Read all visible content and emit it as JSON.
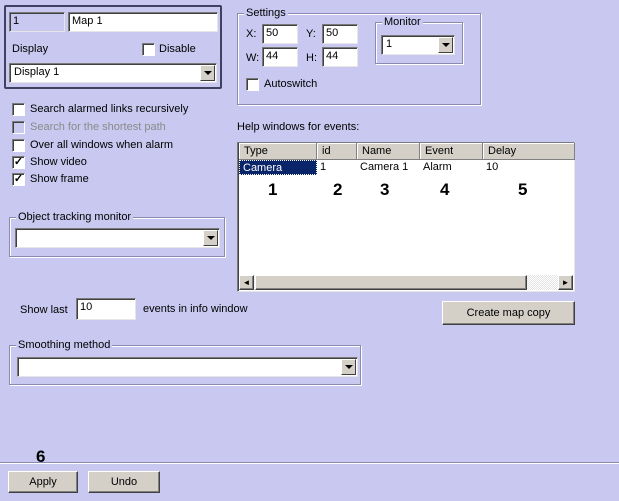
{
  "map": {
    "id": "1",
    "name": "Map 1",
    "display_label": "Display",
    "disable_label": "Disable",
    "display_value": "Display 1"
  },
  "settings": {
    "title": "Settings",
    "x_label": "X:",
    "x": "50",
    "y_label": "Y:",
    "y": "50",
    "w_label": "W:",
    "w": "44",
    "h_label": "H:",
    "h": "44",
    "autoswitch_label": "Autoswitch",
    "monitor_title": "Monitor",
    "monitor_value": "1"
  },
  "options": {
    "search_alarmed": "Search alarmed links recursively",
    "search_shortest": "Search for the shortest path",
    "over_all": "Over all windows when alarm",
    "show_video": "Show video",
    "show_frame": "Show frame",
    "show_video_checked": "✓",
    "show_frame_checked": "✓"
  },
  "tracking": {
    "title": "Object tracking monitor",
    "value": ""
  },
  "help": {
    "title": "Help windows for events:",
    "columns": [
      "Type",
      "id",
      "Name",
      "Event",
      "Delay"
    ],
    "row": [
      "Camera",
      "1",
      "Camera 1",
      "Alarm",
      "10"
    ]
  },
  "show_last": {
    "label": "Show last",
    "value": "10",
    "suffix": "events in info window"
  },
  "create_map_copy": "Create map copy",
  "smoothing": {
    "title": "Smoothing method",
    "value": ""
  },
  "footer": {
    "apply": "Apply",
    "undo": "Undo"
  },
  "callouts": [
    "1",
    "2",
    "3",
    "4",
    "5",
    "6"
  ],
  "scroll": {
    "left": "◄",
    "right": "►"
  }
}
